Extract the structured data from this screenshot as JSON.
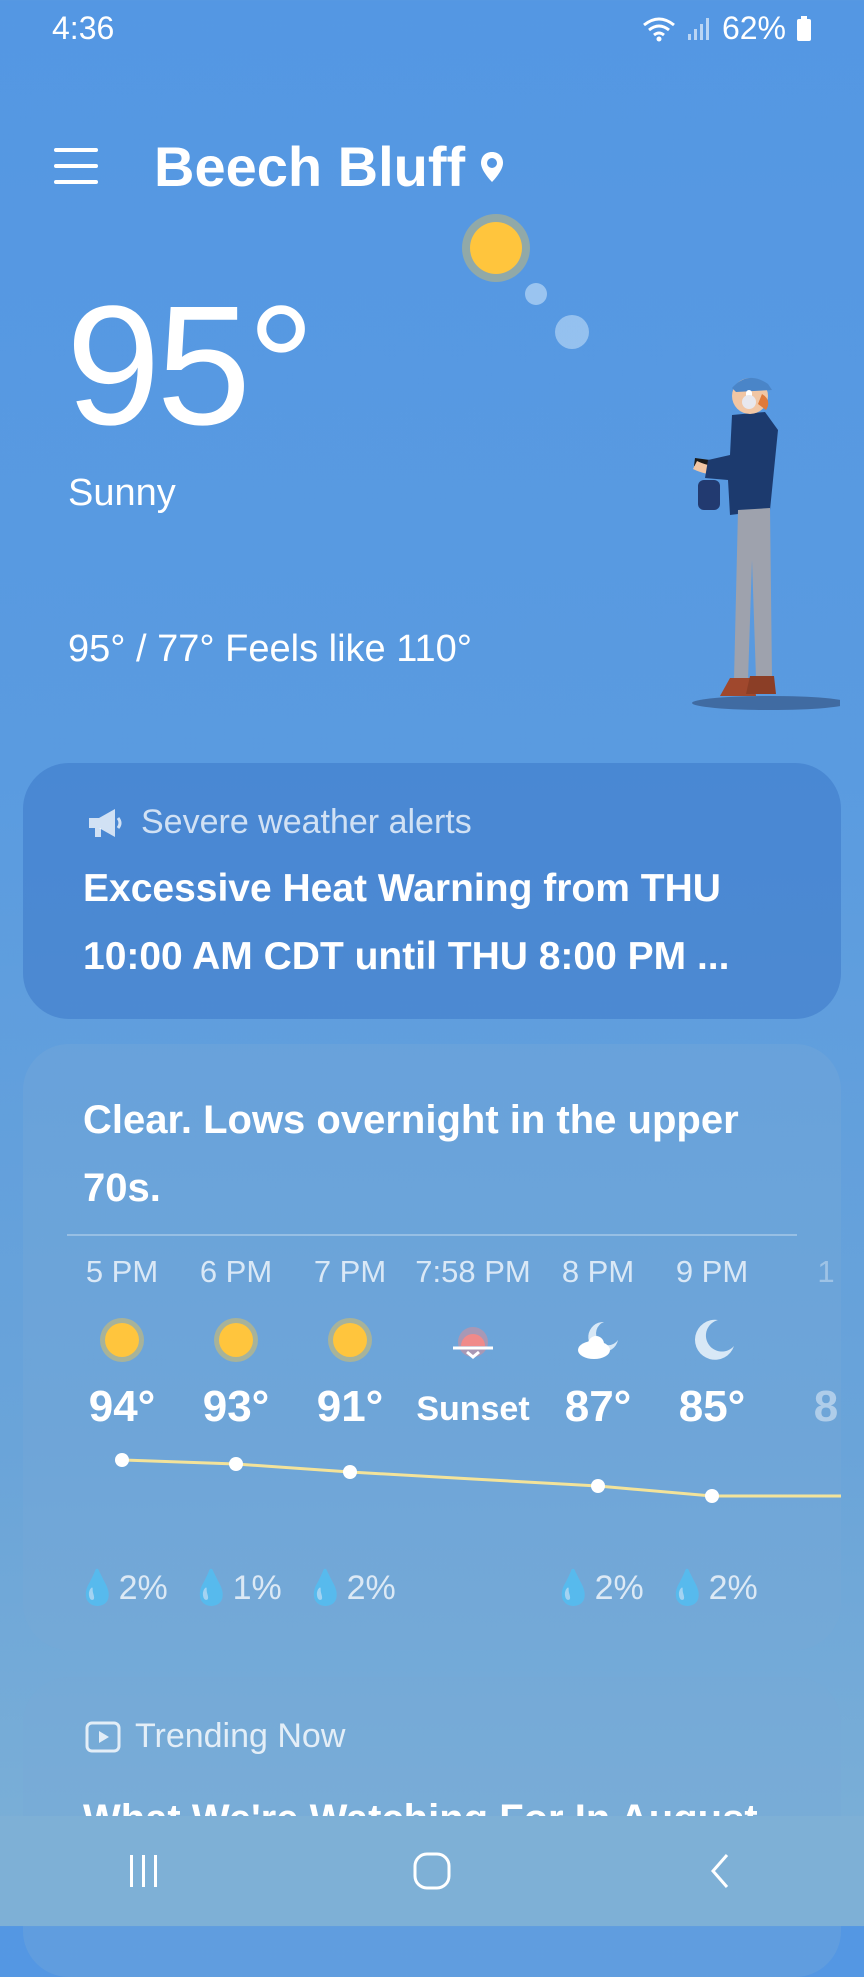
{
  "status_bar": {
    "time": "4:36",
    "battery": "62%"
  },
  "header": {
    "location": "Beech Bluff"
  },
  "current": {
    "temperature": "95°",
    "condition": "Sunny",
    "hi_lo_feels": "95° / 77° Feels like 110°"
  },
  "alert": {
    "heading": "Severe weather alerts",
    "text": "Excessive Heat Warning from THU 10:00 AM CDT until THU 8:00 PM ..."
  },
  "forecast": {
    "summary": "Clear. Lows overnight in the upper 70s.",
    "hours": [
      {
        "time": "5 PM",
        "icon": "sun-icon",
        "temp": "94°",
        "precip": "2%"
      },
      {
        "time": "6 PM",
        "icon": "sun-icon",
        "temp": "93°",
        "precip": "1%"
      },
      {
        "time": "7 PM",
        "icon": "sun-icon",
        "temp": "91°",
        "precip": "2%"
      },
      {
        "time": "7:58 PM",
        "icon": "sunset-icon",
        "temp": "Sunset",
        "precip": ""
      },
      {
        "time": "8 PM",
        "icon": "moon-cloud-icon",
        "temp": "87°",
        "precip": "2%"
      },
      {
        "time": "9 PM",
        "icon": "moon-icon",
        "temp": "85°",
        "precip": "2%"
      },
      {
        "time": "1",
        "icon": "moon-icon",
        "temp": "8",
        "precip": ""
      }
    ]
  },
  "trending": {
    "heading": "Trending Now",
    "title": "What We're Watching For In August"
  },
  "colors": {
    "sun": "#ffc53d",
    "sunset": "#f08a8a",
    "line": "#f3e39a"
  }
}
